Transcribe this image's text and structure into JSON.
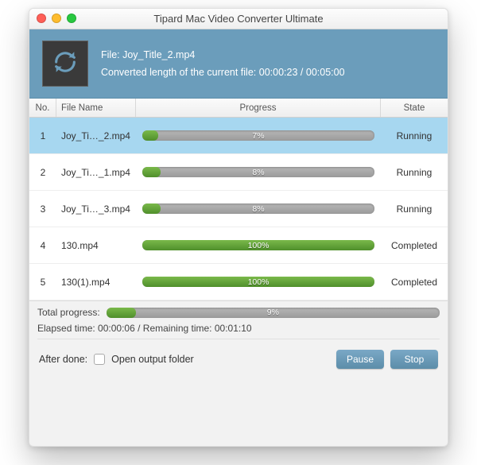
{
  "window": {
    "title": "Tipard Mac Video Converter Ultimate"
  },
  "info": {
    "file_label": "File:",
    "file_name": "Joy_Title_2.mp4",
    "length_label": "Converted length of the current file:",
    "length_elapsed": "00:00:23",
    "length_sep": "/",
    "length_total": "00:05:00",
    "icon": "refresh-icon"
  },
  "columns": {
    "no": "No.",
    "name": "File Name",
    "progress": "Progress",
    "state": "State"
  },
  "rows": [
    {
      "no": "1",
      "name": "Joy_Ti…_2.mp4",
      "pct": "7%",
      "fill": 7,
      "state": "Running",
      "selected": true
    },
    {
      "no": "2",
      "name": "Joy_Ti…_1.mp4",
      "pct": "8%",
      "fill": 8,
      "state": "Running",
      "selected": false
    },
    {
      "no": "3",
      "name": "Joy_Ti…_3.mp4",
      "pct": "8%",
      "fill": 8,
      "state": "Running",
      "selected": false
    },
    {
      "no": "4",
      "name": "130.mp4",
      "pct": "100%",
      "fill": 100,
      "state": "Completed",
      "selected": false
    },
    {
      "no": "5",
      "name": "130(1).mp4",
      "pct": "100%",
      "fill": 100,
      "state": "Completed",
      "selected": false
    }
  ],
  "summary": {
    "total_label": "Total progress:",
    "total_pct": "9%",
    "total_fill": 9,
    "elapsed_label": "Elapsed time:",
    "elapsed_value": "00:00:06",
    "sep": "/",
    "remaining_label": "Remaining time:",
    "remaining_value": "00:01:10"
  },
  "footer": {
    "after_done_label": "After done:",
    "open_folder_label": "Open output folder",
    "pause": "Pause",
    "stop": "Stop"
  }
}
